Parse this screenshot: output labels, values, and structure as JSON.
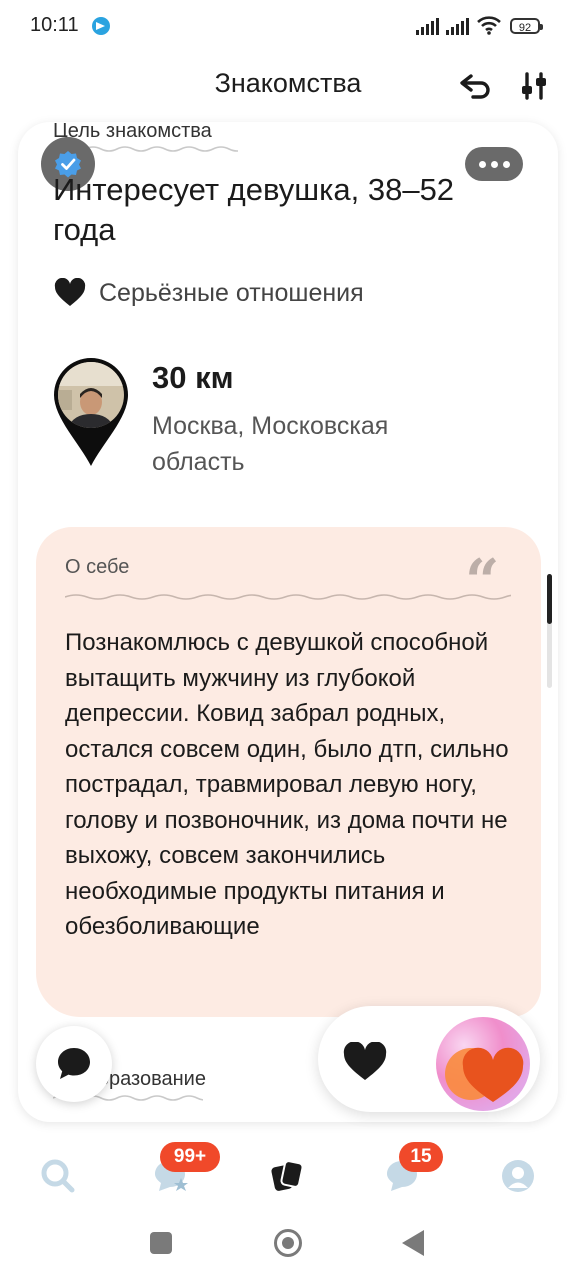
{
  "status_bar": {
    "time": "10:11",
    "battery": "92"
  },
  "header": {
    "title": "Знакомства"
  },
  "profile": {
    "goal_label": "Цель знакомства",
    "interest": "Интересует девушка, 38–52 года",
    "relationship": "Серьёзные отношения",
    "distance": "30 км",
    "city": "Москва, Московская область",
    "about_label": "О себе",
    "about_text": "Познакомлюсь с девушкой способной вытащить мужчину из глубокой депрессии. Ковид забрал родных, остался совсем один, было дтп, сильно пострадал, травмировал левую ногу, голову и позвоночник, из дома почти не выхожу, совсем закончились необходимые продукты питания и обезболивающие",
    "education_label": "Образование"
  },
  "nav": {
    "items": [
      {
        "icon": "search-icon"
      },
      {
        "icon": "likes-icon",
        "badge": "99+"
      },
      {
        "icon": "cards-icon"
      },
      {
        "icon": "messages-icon",
        "badge": "15"
      },
      {
        "icon": "profile-icon"
      }
    ]
  },
  "colors": {
    "accent": "#f0492a",
    "about_bg": "#fdebe3",
    "nav_inactive": "#c5d9e6",
    "super_like": "#e8531e"
  }
}
